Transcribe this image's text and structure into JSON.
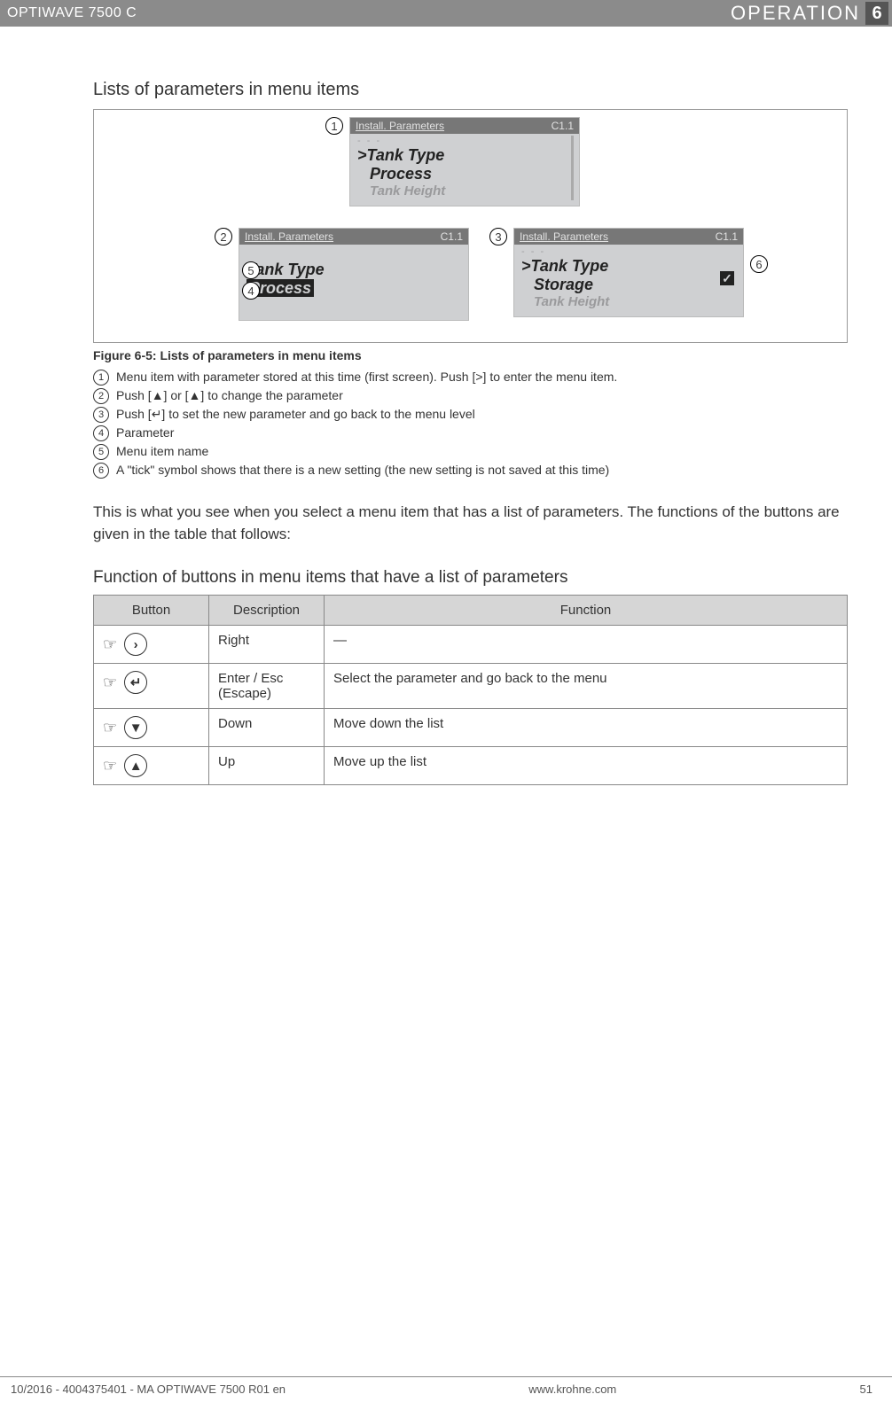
{
  "header": {
    "product": "OPTIWAVE 7500 C",
    "section": "OPERATION",
    "chapter": "6"
  },
  "sec1_title": "Lists of parameters in menu items",
  "figure": {
    "caption": "Figure 6-5: Lists of parameters in menu items",
    "panel_hdr_title": "Install. Parameters",
    "panel_hdr_code": "C1.1",
    "dashes": "- - -",
    "p1": {
      "line1": ">Tank Type",
      "line2": "Process",
      "line3": "Tank Height"
    },
    "p2": {
      "line1": "Tank Type",
      "line2": "Process"
    },
    "p3": {
      "line1": ">Tank Type",
      "line2": "Storage",
      "line3": "Tank Height"
    },
    "tick_glyph": "✓"
  },
  "legend": [
    "Menu item with parameter stored at this time (first screen). Push [>] to enter the menu item.",
    "Push [▲] or [▲] to change the parameter",
    "Push [↵] to set the new parameter and go back to the menu level",
    "Parameter",
    "Menu item name",
    "A \"tick\" symbol shows that there is a new setting (the new setting is not saved at this time)"
  ],
  "paragraph": "This is what you see when you select a menu item that has a list of parameters. The functions of the buttons are given in the table that follows:",
  "table": {
    "title": "Function of buttons in menu items that have a list of parameters",
    "headers": [
      "Button",
      "Description",
      "Function"
    ],
    "rows": [
      {
        "glyph": "›",
        "desc": "Right",
        "func": "—"
      },
      {
        "glyph": "↵",
        "desc": "Enter / Esc (Escape)",
        "func": "Select the parameter and go back to the menu"
      },
      {
        "glyph": "▼",
        "desc": "Down",
        "func": "Move down the list"
      },
      {
        "glyph": "▲",
        "desc": "Up",
        "func": "Move up the list"
      }
    ]
  },
  "footer": {
    "left": "10/2016 - 4004375401 - MA OPTIWAVE 7500 R01 en",
    "center": "www.krohne.com",
    "page": "51"
  },
  "hand_glyph": "☞"
}
